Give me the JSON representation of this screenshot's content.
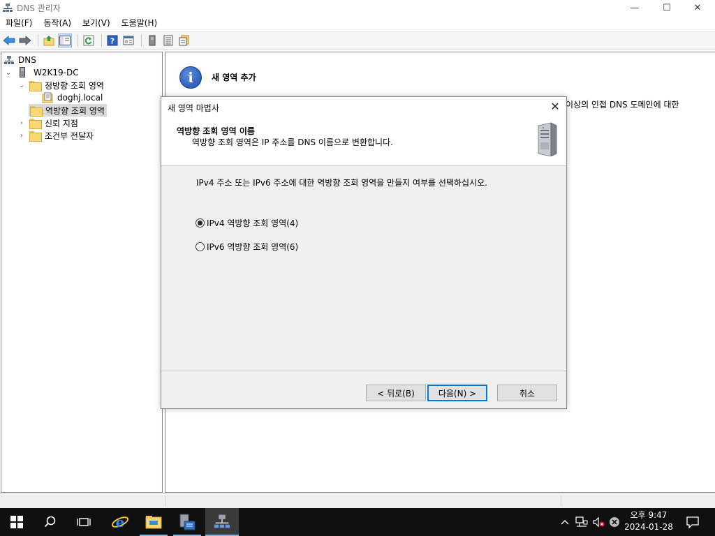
{
  "window": {
    "title": "DNS 관리자",
    "controls": {
      "minimize": "—",
      "maximize": "☐",
      "close": "✕"
    }
  },
  "menu": [
    "파일(F)",
    "동작(A)",
    "보기(V)",
    "도움말(H)"
  ],
  "toolbar": {
    "icons": [
      "back-arrow-icon",
      "forward-arrow-icon",
      "up-folder-icon",
      "show-hide-tree-icon",
      "refresh-icon",
      "help-icon",
      "properties-icon",
      "server-icon",
      "list-icon",
      "export-icon"
    ]
  },
  "tree": {
    "root": "DNS",
    "server": "W2K19-DC",
    "forward_zones": "정방향 조회 영역",
    "zone": "doghj.local",
    "reverse_zones": "역방향 조회 영역",
    "trust_points": "신뢰 지점",
    "conditional_forwarders": "조건부 전달자"
  },
  "content": {
    "info_title": "새 영역 추가",
    "text_fragment": "이상의 인접 DNS 도메인에 대한"
  },
  "dialog": {
    "title": "새 영역 마법사",
    "header_title": "역방향 조회 영역 이름",
    "header_subtitle": "역방향 조회 영역은 IP 주소를 DNS 이름으로 변환합니다.",
    "description": "IPv4 주소 또는 IPv6 주소에 대한 역방향 조회 영역을 만들지 여부를 선택하십시오.",
    "options": [
      {
        "label": "IPv4 역방향 조회 영역(4)",
        "checked": true
      },
      {
        "label": "IPv6 역방향 조회 영역(6)",
        "checked": false
      }
    ],
    "buttons": {
      "back": "< 뒤로(B)",
      "next": "다음(N) >",
      "cancel": "취소"
    }
  },
  "taskbar": {
    "time": "오후 9:47",
    "date": "2024-01-28"
  },
  "colors": {
    "accent": "#0078d7",
    "taskbar": "#101010",
    "folder": "#f8d775"
  }
}
